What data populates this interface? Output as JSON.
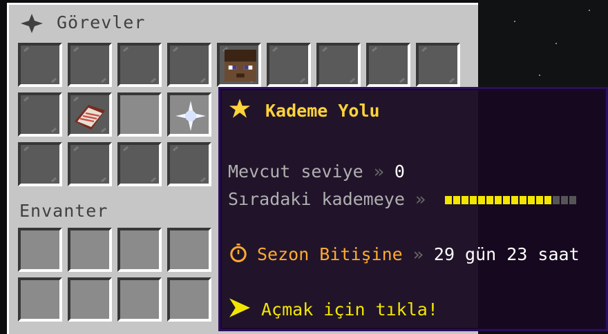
{
  "menu": {
    "title": "Görevler",
    "inventory_label": "Envanter"
  },
  "tooltip": {
    "title": "Kademe Yolu",
    "level_label": "Mevcut seviye",
    "level_sep": "»",
    "level_value": "0",
    "next_label": "Sıradaki kademeye",
    "next_sep": "»",
    "progress": {
      "filled": 13,
      "total": 16
    },
    "season_label": "Sezon Bitişine",
    "season_sep": "»",
    "season_value": "29 gün 23 saat",
    "action_text": "Açmak için tıkla!"
  },
  "colors": {
    "title": "#ffd33a",
    "season": "#ffaa2f",
    "label": "#b0b0b0",
    "value": "#ffffff",
    "tooltip_bg": "#160820",
    "tooltip_border": "#2b0f5a"
  },
  "items": {
    "player_head": "player-head-icon",
    "book": "enchanted-book-icon",
    "nether_star": "nether-star-icon"
  }
}
